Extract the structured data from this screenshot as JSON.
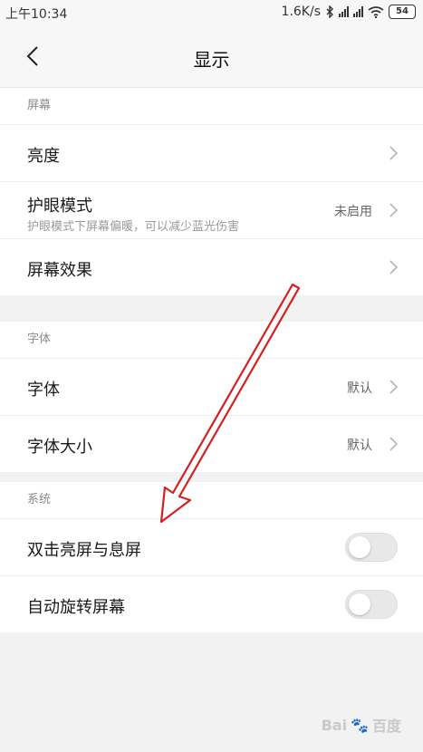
{
  "status_bar": {
    "time": "上午10:34",
    "network_speed": "1.6K/s",
    "battery": "54"
  },
  "header": {
    "title": "显示"
  },
  "sections": {
    "screen": {
      "label": "屏幕",
      "brightness": {
        "label": "亮度"
      },
      "eye_care": {
        "label": "护眼模式",
        "subtitle": "护眼模式下屏幕偏暖，可以减少蓝光伤害",
        "value": "未启用"
      },
      "screen_effect": {
        "label": "屏幕效果"
      }
    },
    "font": {
      "label": "字体",
      "font_style": {
        "label": "字体",
        "value": "默认"
      },
      "font_size": {
        "label": "字体大小",
        "value": "默认"
      }
    },
    "system": {
      "label": "系统",
      "double_tap": {
        "label": "双击亮屏与息屏",
        "enabled": false
      },
      "auto_rotate": {
        "label": "自动旋转屏幕",
        "enabled": false
      }
    }
  },
  "watermark": {
    "text": "Bai",
    "suffix": "百度",
    "url": "jingyan.baidu.com"
  },
  "colors": {
    "annotation_arrow": "#d42020",
    "page_bg": "#f2f2f2"
  }
}
